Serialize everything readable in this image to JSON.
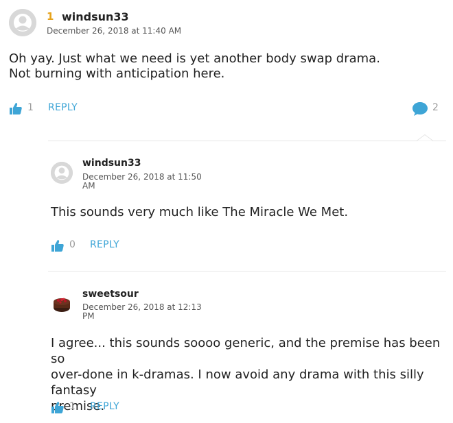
{
  "comments": [
    {
      "rank": "1",
      "author": "windsun33",
      "date": "December 26, 2018 at 11:40 AM",
      "body_line1": "Oh yay. Just what we need is yet another body swap drama.",
      "body_line2": "Not burning with anticipation here.",
      "likes": "1",
      "reply_label": "REPLY",
      "reply_count": "2"
    },
    {
      "author": "windsun33",
      "date_line1": "December 26, 2018 at 11:50",
      "date_line2": "AM",
      "body": "This sounds very much like The Miracle We Met.",
      "likes": "0",
      "reply_label": "REPLY"
    },
    {
      "author": "sweetsour",
      "date_line1": "December 26, 2018 at 12:13",
      "date_line2": "PM",
      "body_line1": "I agree... this sounds soooo generic, and the premise has been so",
      "body_line2": "over-done in k-dramas. I now avoid any drama with this silly fantasy",
      "body_line3": "premise.",
      "likes": "1",
      "reply_label": "REPLY"
    }
  ],
  "colors": {
    "accent": "#3ea5d6",
    "rank": "#e6a21a"
  }
}
